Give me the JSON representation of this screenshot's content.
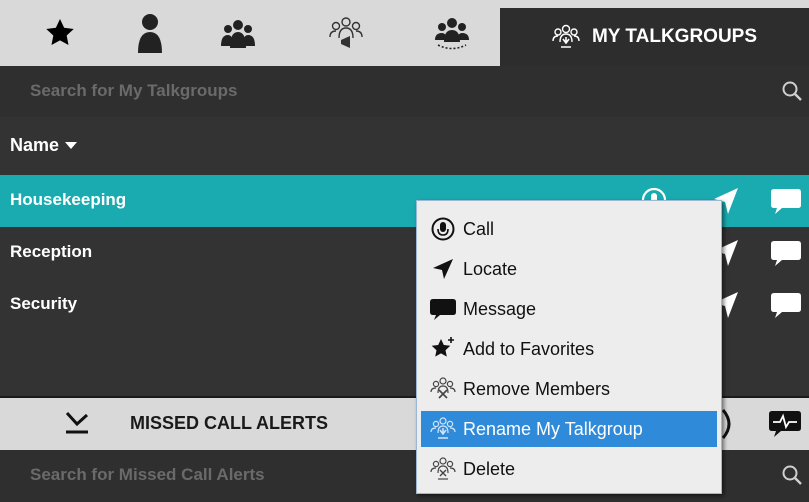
{
  "tabs": {
    "favorites_icon": "star-icon",
    "contact_icon": "person-icon",
    "groups_icon": "group-icon",
    "broadcast_icon": "broadcast-group-icon",
    "dynamic_icon": "dynamic-group-icon",
    "active_label": "MY TALKGROUPS"
  },
  "search": {
    "placeholder": "Search for My Talkgroups"
  },
  "header": {
    "name_label": "Name"
  },
  "talkgroups": [
    {
      "name": "Housekeeping",
      "selected": true
    },
    {
      "name": "Reception",
      "selected": false
    },
    {
      "name": "Security",
      "selected": false
    }
  ],
  "context_menu": {
    "items": [
      {
        "label": "Call",
        "icon": "call-icon"
      },
      {
        "label": "Locate",
        "icon": "locate-icon"
      },
      {
        "label": "Message",
        "icon": "message-icon"
      },
      {
        "label": "Add to Favorites",
        "icon": "add-favorite-icon"
      },
      {
        "label": "Remove Members",
        "icon": "remove-members-icon"
      },
      {
        "label": "Rename My Talkgroup",
        "icon": "rename-icon"
      },
      {
        "label": "Delete",
        "icon": "delete-icon"
      }
    ],
    "highlighted_index": 5
  },
  "missed": {
    "title": "MISSED CALL ALERTS",
    "search_placeholder": "Search for Missed Call Alerts"
  },
  "colors": {
    "accent": "#1aabb0",
    "menu_highlight": "#2f8bd9",
    "panel": "#333333",
    "tabbar": "#d9d9d9"
  }
}
